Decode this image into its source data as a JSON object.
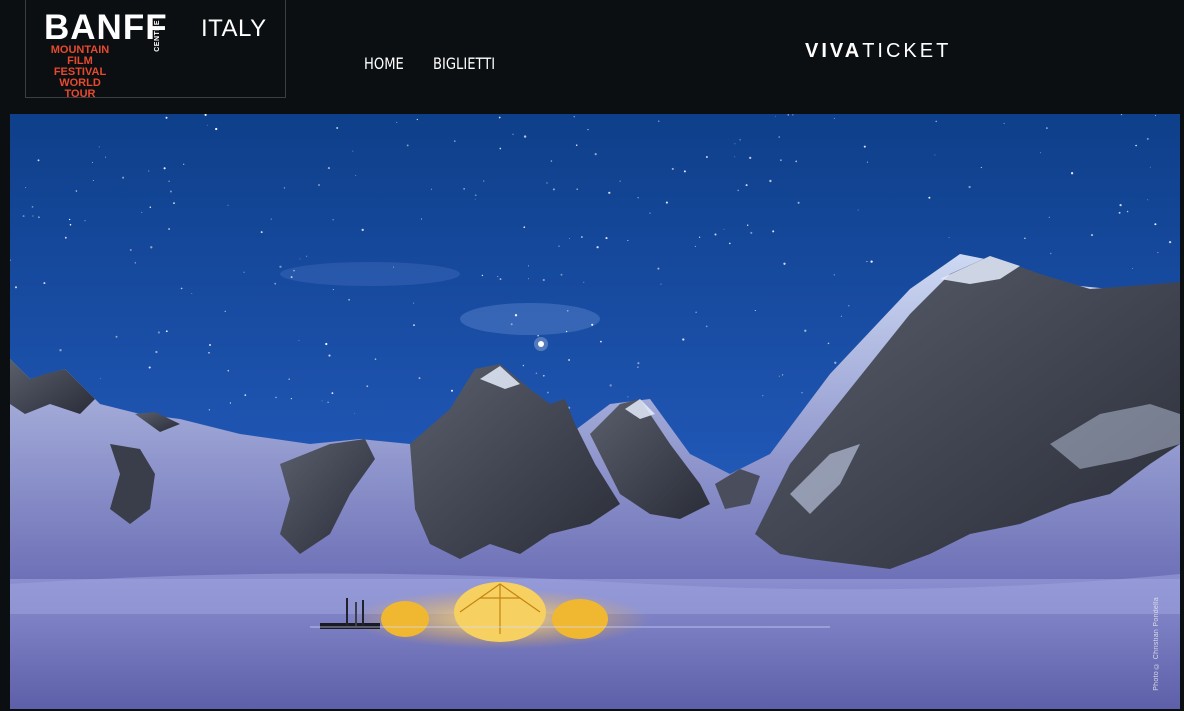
{
  "header": {
    "logo": {
      "brand": "BANFF",
      "centre": "CENTRE",
      "tagline": [
        "MOUNTAIN",
        "FILM FESTIVAL",
        "WORLD TOUR"
      ],
      "country": "ITALY"
    },
    "nav": [
      {
        "label": "HOME"
      },
      {
        "label": "BIGLIETTI"
      }
    ],
    "partner": {
      "bold": "VIVA",
      "light": "TICKET"
    }
  },
  "hero": {
    "credit": "Photo © Christian Pondella"
  },
  "colors": {
    "background": "#0b0f12",
    "logo_accent": "#e64a2e",
    "sky_top": "#0e3f8a",
    "sky_bottom": "#2f66c4"
  }
}
